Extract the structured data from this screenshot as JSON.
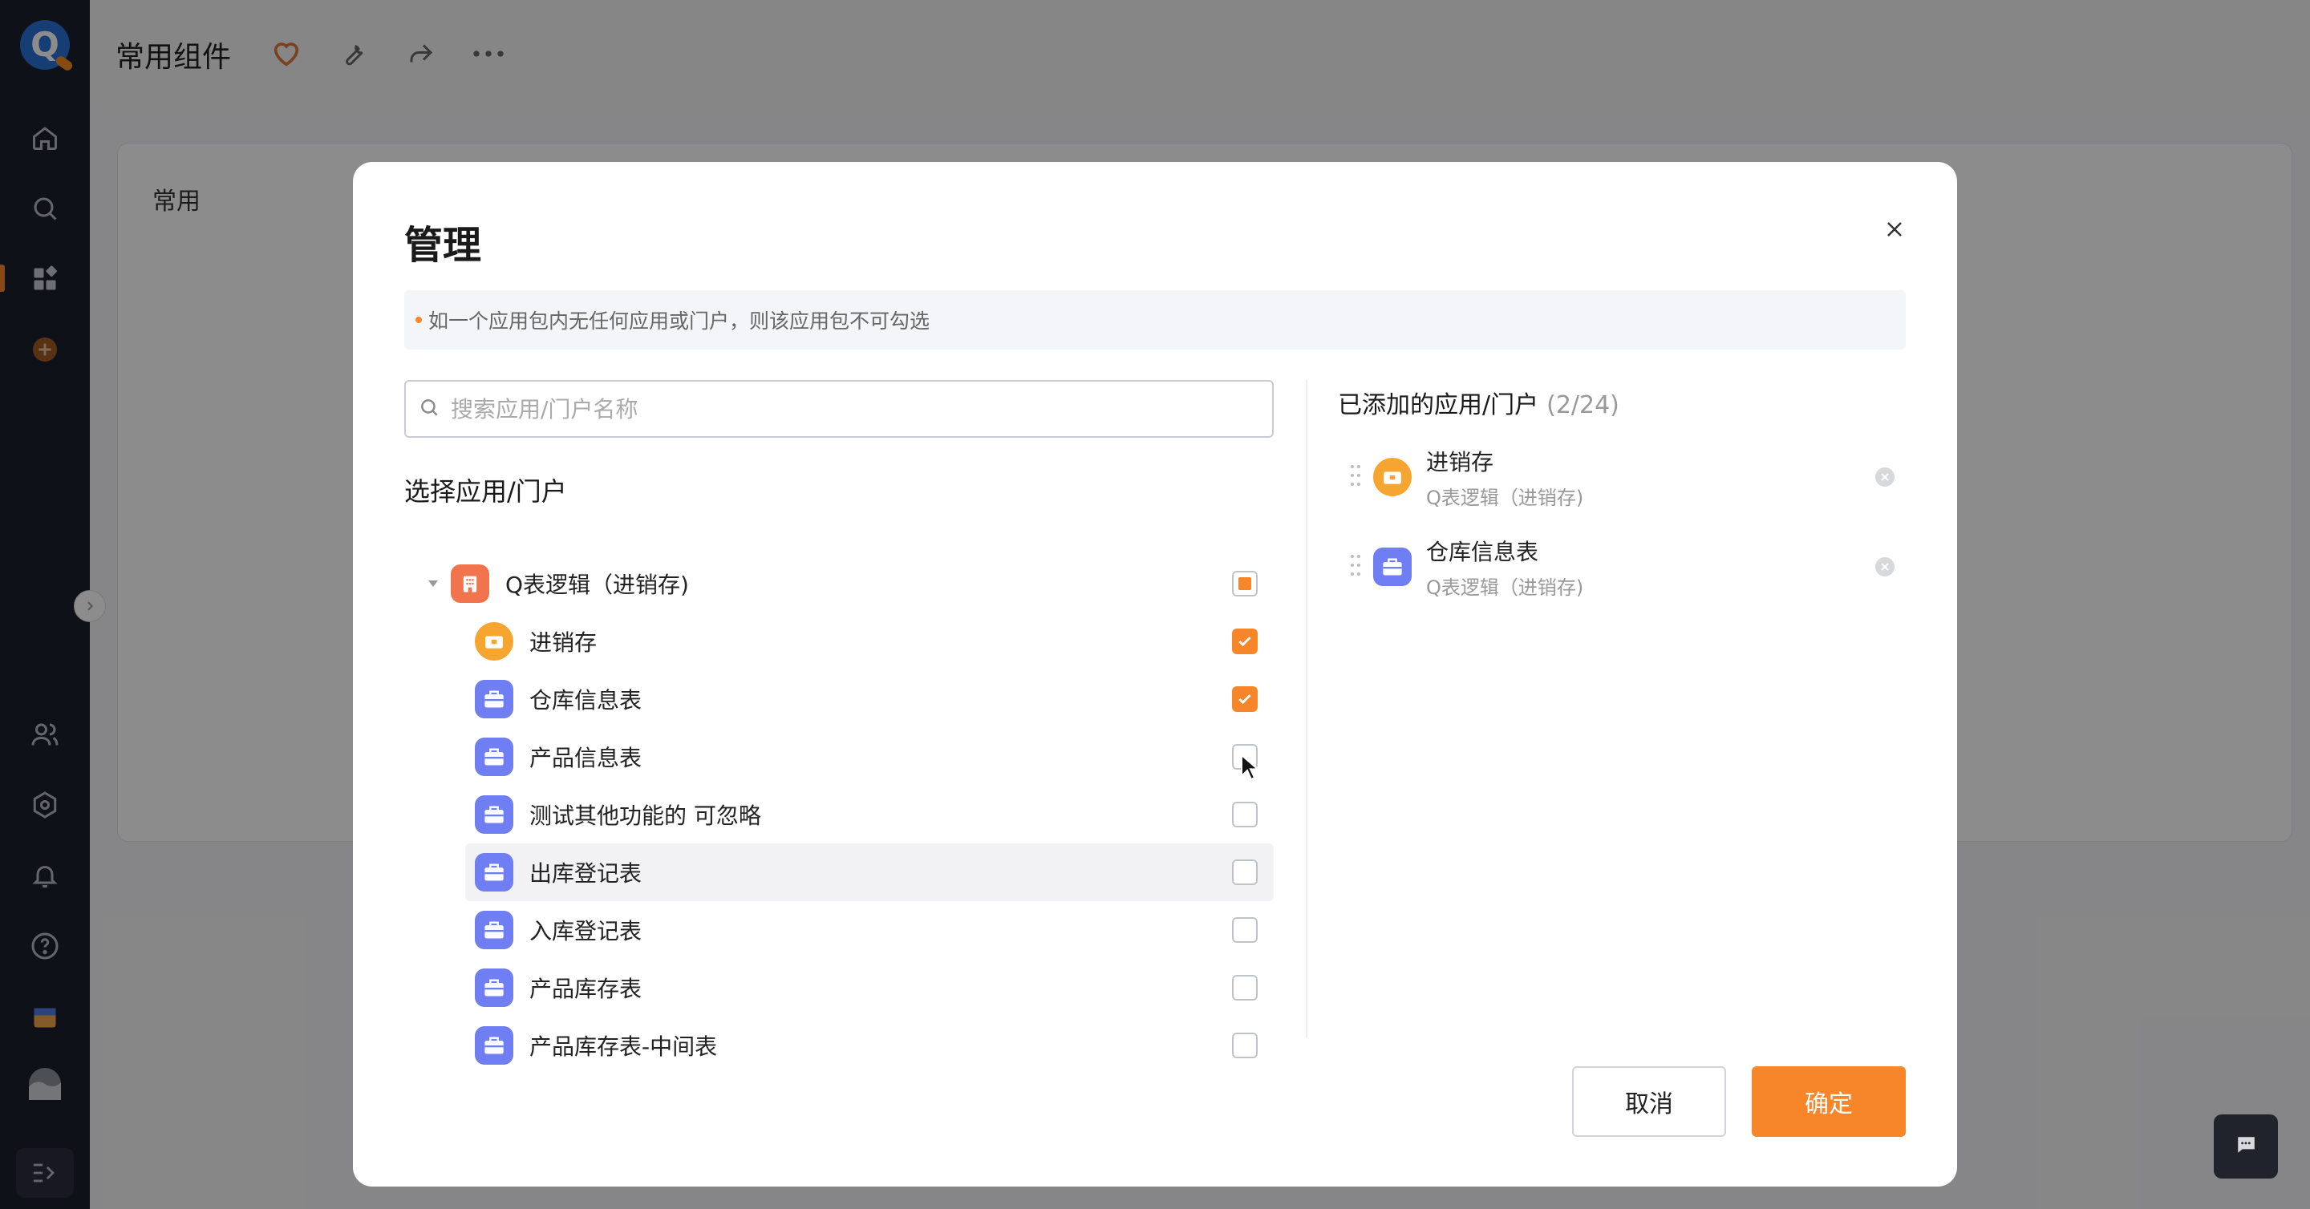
{
  "topbar": {
    "title": "常用组件"
  },
  "card": {
    "title": "常用"
  },
  "modal": {
    "title": "管理",
    "notice": "如一个应用包内无任何应用或门户，则该应用包不可勾选",
    "search": {
      "placeholder": "搜索应用/门户名称",
      "value": ""
    },
    "select_title": "选择应用/门户",
    "tree": {
      "group": {
        "label": "Q表逻辑（进销存)",
        "icon": "building-icon",
        "state": "partial"
      },
      "items": [
        {
          "label": "进销存",
          "icon": "portal-icon",
          "color": "#f7a531",
          "checked": true
        },
        {
          "label": "仓库信息表",
          "icon": "briefcase-icon",
          "color": "#6f7ef2",
          "checked": true
        },
        {
          "label": "产品信息表",
          "icon": "briefcase-icon",
          "color": "#6f7ef2",
          "checked": false
        },
        {
          "label": "测试其他功能的 可忽略",
          "icon": "briefcase-icon",
          "color": "#6f7ef2",
          "checked": false
        },
        {
          "label": "出库登记表",
          "icon": "briefcase-icon",
          "color": "#6f7ef2",
          "checked": false,
          "hover": true
        },
        {
          "label": "入库登记表",
          "icon": "briefcase-icon",
          "color": "#6f7ef2",
          "checked": false
        },
        {
          "label": "产品库存表",
          "icon": "briefcase-icon",
          "color": "#6f7ef2",
          "checked": false
        },
        {
          "label": "产品库存表-中间表",
          "icon": "briefcase-icon",
          "color": "#6f7ef2",
          "checked": false
        }
      ]
    },
    "added": {
      "title": "已添加的应用/门户",
      "count": "(2/24)",
      "items": [
        {
          "name": "进销存",
          "sub": "Q表逻辑（进销存)",
          "icon": "portal-icon"
        },
        {
          "name": "仓库信息表",
          "sub": "Q表逻辑（进销存)",
          "icon": "briefcase-icon"
        }
      ]
    },
    "buttons": {
      "cancel": "取消",
      "ok": "确定"
    }
  },
  "colors": {
    "accent": "#f7862a",
    "sidebar": "#1d1f2e",
    "app_icon": "#6f7ef2"
  }
}
